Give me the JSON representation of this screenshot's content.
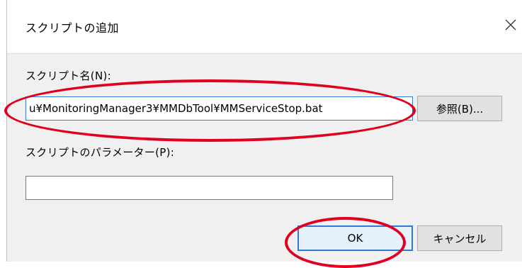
{
  "dialog": {
    "title": "スクリプトの追加",
    "close_symbol": "✕",
    "script_name_label": "スクリプト名(N):",
    "script_name_value": "u¥MonitoringManager3¥MMDbTool¥MMServiceStop.bat",
    "browse_label": "参照(B)...",
    "script_params_label": "スクリプトのパラメーター(P):",
    "script_params_value": "",
    "ok_label": "OK",
    "cancel_label": "キャンセル"
  },
  "colors": {
    "annotation": "#e0001e",
    "focus": "#2f7bd6"
  },
  "icons": {
    "close": "close-icon"
  }
}
